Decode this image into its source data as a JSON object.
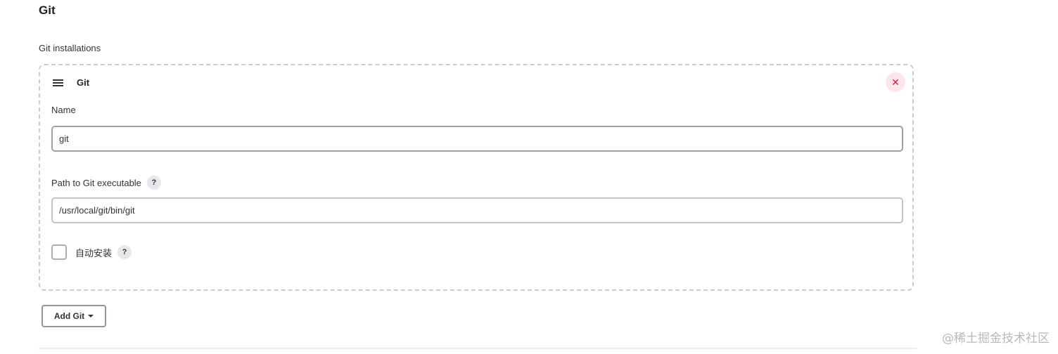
{
  "section": {
    "title": "Git",
    "installations_label": "Git installations"
  },
  "card": {
    "heading": "Git",
    "delete_symbol": "✕",
    "name_label": "Name",
    "name_value": "git",
    "path_label": "Path to Git executable",
    "path_value": "/usr/local/git/bin/git",
    "help_symbol": "?",
    "auto_install_label": "自动安装",
    "auto_install_checked": false
  },
  "actions": {
    "add_label": "Add Git"
  },
  "watermark": "@稀土掘金技术社区",
  "icons": {
    "drag": "drag-handle-icon",
    "delete": "close-icon",
    "help": "help-icon",
    "dropdown": "caret-down-icon"
  },
  "colors": {
    "delete_bg": "#fde6ea",
    "delete_fg": "#d51a3d",
    "border_dashed": "#c9cdd2"
  }
}
